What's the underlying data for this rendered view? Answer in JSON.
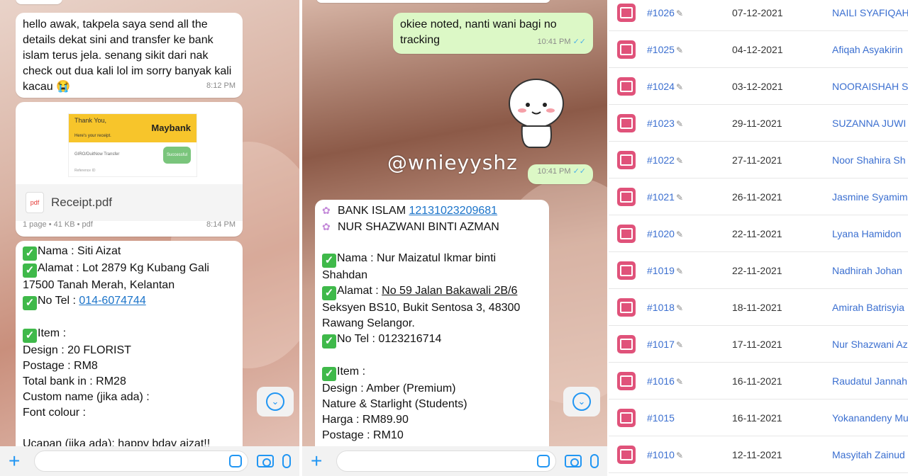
{
  "left_chat": {
    "msg1": {
      "text": "hello awak, takpela saya send all the details dekat sini and transfer ke bank islam terus jela. senang sikit dari nak check out dua kali lol im sorry banyak kali kacau 😭",
      "time": "8:12 PM"
    },
    "receipt_msg": {
      "thank_you": "Thank You,",
      "receipt_sub": "Here's your receipt.",
      "bank_brand": "Maybank",
      "transfer_type": "GIRO/DuitNow Transfer",
      "status": "Successful",
      "ref_label": "Reference ID",
      "file_name": "Receipt.pdf",
      "file_type_icon": "pdf",
      "file_meta": "1 page • 41 KB • pdf",
      "time": "8:14 PM"
    },
    "details_msg": {
      "nama": "Nama : Siti Aizat",
      "alamat_1": "Alamat : Lot 2879 Kg Kubang Gali",
      "alamat_2": "17500 Tanah Merah, Kelantan",
      "tel_label": "No Tel : ",
      "tel_value": "014-6074744",
      "item": "Item :",
      "design": "Design : 20 FLORIST",
      "postage": "Postage : RM8",
      "total": "Total bank in : RM28",
      "custom_name": "Custom name (jika ada) :",
      "font_colour": "Font colour :",
      "ucapan": "Ucapan (jika ada): happy bday aizat!!"
    }
  },
  "middle_chat": {
    "msg1": {
      "text": "okiee noted, nanti wani bagi no tracking",
      "time": "10:41 PM"
    },
    "sticker_time": "10:41 PM",
    "watermark": "@wnieyyshz",
    "details_msg": {
      "bank_label": "BANK ISLAM ",
      "bank_account": "12131023209681",
      "account_name": "NUR SHAZWANI BINTI AZMAN",
      "nama_1": "Nama : Nur Maizatul Ikmar binti",
      "nama_2": "Shahdan",
      "alamat_label": "Alamat : ",
      "alamat_1": "No 59 Jalan Bakawali 2B/6",
      "alamat_2": "Seksyen BS10, Bukit Sentosa 3, 48300",
      "alamat_3": "Rawang Selangor.",
      "tel": "No Tel : 0123216714",
      "item": "Item :",
      "design": "Design : Amber (Premium)",
      "design_2": "Nature & Starlight (Students)",
      "harga": "Harga : RM89.90",
      "postage": "Postage : RM10"
    }
  },
  "orders": [
    {
      "num": "#1026",
      "date": "07-12-2021",
      "name": "NAILI SYAFIQAH",
      "clip": true
    },
    {
      "num": "#1025",
      "date": "04-12-2021",
      "name": "Afiqah Asyakirin",
      "clip": true
    },
    {
      "num": "#1024",
      "date": "03-12-2021",
      "name": "NOORAISHAH S",
      "clip": true
    },
    {
      "num": "#1023",
      "date": "29-11-2021",
      "name": "SUZANNA JUWI",
      "clip": true
    },
    {
      "num": "#1022",
      "date": "27-11-2021",
      "name": "Noor Shahira Sh",
      "clip": true
    },
    {
      "num": "#1021",
      "date": "26-11-2021",
      "name": "Jasmine Syamim",
      "clip": true
    },
    {
      "num": "#1020",
      "date": "22-11-2021",
      "name": "Lyana Hamidon",
      "clip": true
    },
    {
      "num": "#1019",
      "date": "22-11-2021",
      "name": "Nadhirah Johan",
      "clip": true
    },
    {
      "num": "#1018",
      "date": "18-11-2021",
      "name": "Amirah Batrisyia",
      "clip": true
    },
    {
      "num": "#1017",
      "date": "17-11-2021",
      "name": "Nur Shazwani Az",
      "clip": true
    },
    {
      "num": "#1016",
      "date": "16-11-2021",
      "name": "Raudatul Jannah",
      "clip": true
    },
    {
      "num": "#1015",
      "date": "16-11-2021",
      "name": "Yokanandeny Mu",
      "clip": false
    },
    {
      "num": "#1010",
      "date": "12-11-2021",
      "name": "Masyitah Zainud",
      "clip": true
    }
  ],
  "icons": {
    "check": "check-mark-icon",
    "fairy": "fairy-icon",
    "plus": "plus-icon",
    "sticker": "sticker-icon",
    "camera": "camera-icon",
    "mic": "microphone-icon",
    "scroll_down": "chevron-down-icon",
    "order": "store-icon",
    "clip": "paperclip-icon"
  },
  "colors": {
    "outgoing_bubble": "#dcf8c6",
    "link": "#1a73c9",
    "ticks": "#4fb3e8",
    "check_green": "#3fb94a",
    "order_icon": "#e0527a",
    "order_link": "#3b6fd0",
    "input_accent": "#2196f3"
  }
}
